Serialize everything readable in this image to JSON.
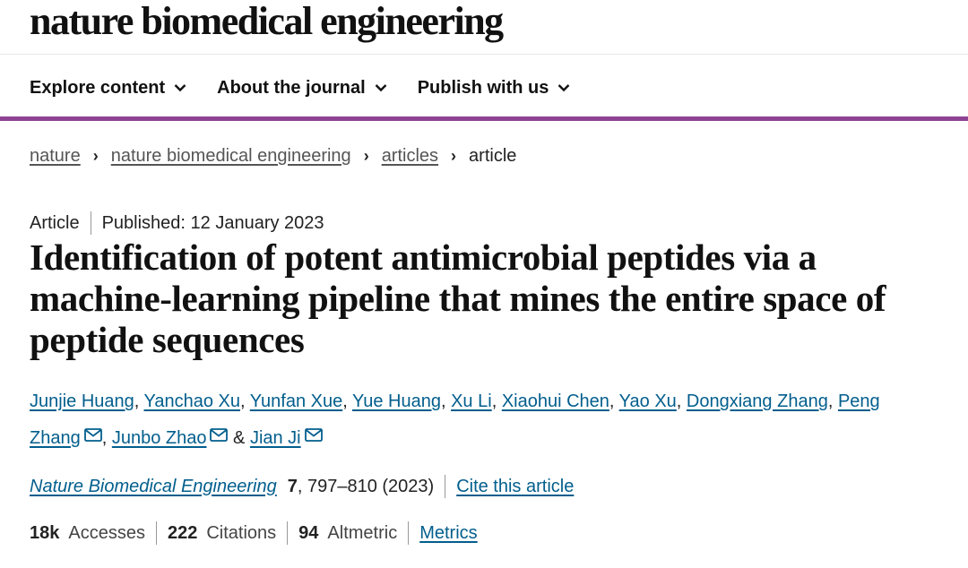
{
  "header": {
    "logo": "nature biomedical engineering"
  },
  "nav": {
    "items": [
      "Explore content",
      "About the journal",
      "Publish with us"
    ]
  },
  "breadcrumb": {
    "items": [
      "nature",
      "nature biomedical engineering",
      "articles"
    ],
    "current": "article"
  },
  "article": {
    "type": "Article",
    "published": "Published: 12 January 2023",
    "title": "Identification of potent antimicrobial peptides via a machine-learning pipeline that mines the entire space of peptide sequences",
    "authors": [
      "Junjie Huang",
      "Yanchao Xu",
      "Yunfan Xue",
      "Yue Huang",
      "Xu Li",
      "Xiaohui Chen",
      "Yao Xu",
      "Dongxiang Zhang",
      "Peng Zhang",
      "Junbo Zhao",
      "Jian Ji"
    ],
    "author_separator": ", ",
    "author_and": " & ",
    "citation": {
      "journal": "Nature Biomedical Engineering",
      "volume": "7",
      "pages": ", 797–810 (2023)",
      "cite_link": "Cite this article"
    },
    "metrics": {
      "accesses_value": "18k",
      "accesses_label": "Accesses",
      "citations_value": "222",
      "citations_label": "Citations",
      "altmetric_value": "94",
      "altmetric_label": "Altmetric",
      "metrics_link": "Metrics"
    }
  },
  "icons": {
    "nav_chevron": "chevron-down-icon",
    "corresponding_author": "mail-icon"
  },
  "colors": {
    "accent_bar": "#8e4493",
    "link": "#025e8d"
  }
}
